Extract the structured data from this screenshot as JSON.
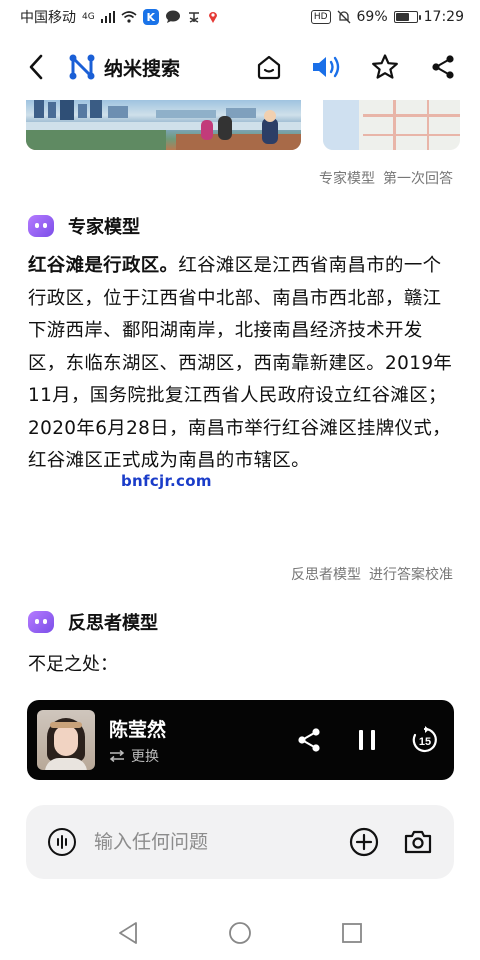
{
  "status_bar": {
    "carrier": "中国移动",
    "network": "4G",
    "k_badge": "K",
    "hd": "HD",
    "battery_percent": "69%",
    "battery_level": 0.69,
    "time": "17:29"
  },
  "header": {
    "app_title": "纳米搜索",
    "brand_color": "#1a5fd6",
    "speaker_color": "#1a6fe8"
  },
  "expert": {
    "meta_model": "专家模型",
    "meta_note": "第一次回答",
    "title": "专家模型",
    "answer_bold": "红谷滩是行政区。",
    "answer_text": "红谷滩区是江西省南昌市的一个行政区，位于江西省中北部、南昌市西北部，赣江下游西岸、鄱阳湖南岸，北接南昌经济技术开发区，东临东湖区、西湖区，西南靠新建区。2019年11月，国务院批复江西省人民政府设立红谷滩区；2020年6月28日，南昌市举行红谷滩区挂牌仪式，红谷滩区正式成为南昌的市辖区。",
    "watermark": "bnfcjr.com"
  },
  "reflector": {
    "meta_model": "反思者模型",
    "meta_note": "进行答案校准",
    "title": "反思者模型",
    "subline": "不足之处："
  },
  "player": {
    "name": "陈莹然",
    "switch_label": "更换",
    "replay_seconds": "15"
  },
  "input": {
    "placeholder": "输入任何问题",
    "value": ""
  }
}
